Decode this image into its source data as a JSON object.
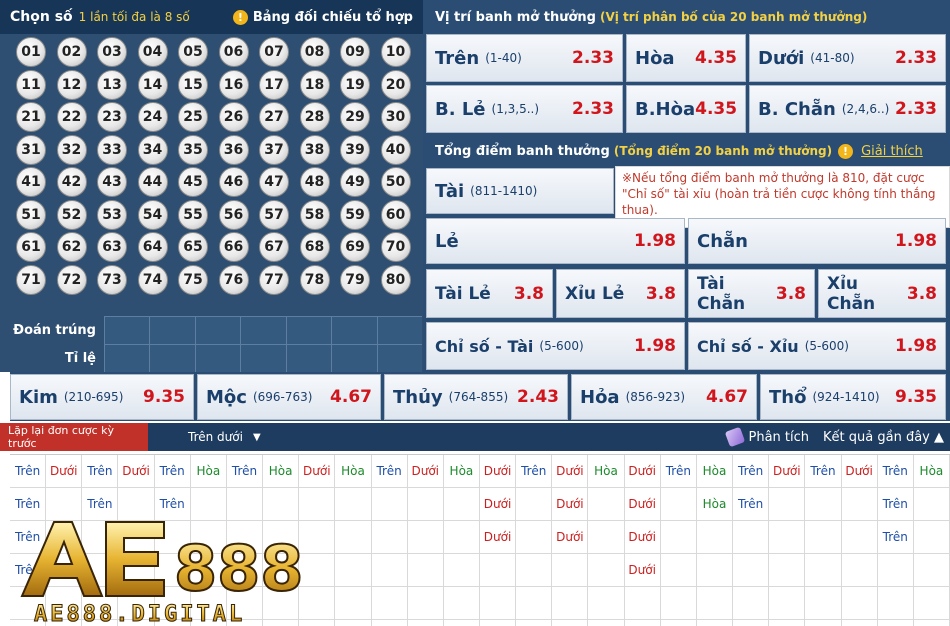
{
  "left": {
    "title": "Chọn số",
    "subtitle": "1 lần tối đa là 8 số",
    "compare_label": "Bảng đối chiếu tổ hợp",
    "balls": [
      "01",
      "02",
      "03",
      "04",
      "05",
      "06",
      "07",
      "08",
      "09",
      "10",
      "11",
      "12",
      "13",
      "14",
      "15",
      "16",
      "17",
      "18",
      "19",
      "20",
      "21",
      "22",
      "23",
      "24",
      "25",
      "26",
      "27",
      "28",
      "29",
      "30",
      "31",
      "32",
      "33",
      "34",
      "35",
      "36",
      "37",
      "38",
      "39",
      "40",
      "41",
      "42",
      "43",
      "44",
      "45",
      "46",
      "47",
      "48",
      "49",
      "50",
      "51",
      "52",
      "53",
      "54",
      "55",
      "56",
      "57",
      "58",
      "59",
      "60",
      "61",
      "62",
      "63",
      "64",
      "65",
      "66",
      "67",
      "68",
      "69",
      "70",
      "71",
      "72",
      "73",
      "74",
      "75",
      "76",
      "77",
      "78",
      "79",
      "80"
    ],
    "win_label": "Đoán trúng",
    "ratio_label": "Tỉ lệ"
  },
  "position": {
    "title": "Vị trí banh mở thưởng",
    "subtitle": "(Vị trí phân bố của 20 banh mở thưởng)",
    "odds": [
      {
        "label": "Trên",
        "range": "(1-40)",
        "value": "2.33"
      },
      {
        "label": "Hòa",
        "range": "",
        "value": "4.35"
      },
      {
        "label": "Dưới",
        "range": "(41-80)",
        "value": "2.33"
      },
      {
        "label": "B. Lẻ",
        "range": "(1,3,5..)",
        "value": "2.33"
      },
      {
        "label": "B.Hòa",
        "range": "",
        "value": "4.35"
      },
      {
        "label": "B. Chẵn",
        "range": "(2,4,6..)",
        "value": "2.33"
      }
    ]
  },
  "sum": {
    "title": "Tổng điểm banh thưởng",
    "subtitle": "(Tổng điểm 20 banh mở thưởng)",
    "explain_link": "Giải thích",
    "tooltip": "※Nếu tổng điểm banh mở thưởng là 810, đặt cược \"Chỉ số\" tài xỉu (hoàn trả tiền cược không tính thắng thua).",
    "tai": {
      "label": "Tài",
      "range": "(811-1410)"
    },
    "le": {
      "label": "Lẻ",
      "value": "1.98"
    },
    "chan": {
      "label": "Chẵn",
      "value": "1.98"
    },
    "combos": [
      {
        "label": "Tài Lẻ",
        "value": "3.8"
      },
      {
        "label": "Xỉu Lẻ",
        "value": "3.8"
      },
      {
        "label": "Tài Chẵn",
        "value": "3.8"
      },
      {
        "label": "Xỉu Chẵn",
        "value": "3.8"
      }
    ],
    "index": [
      {
        "label": "Chỉ số - Tài",
        "range": "(5-600)",
        "value": "1.98"
      },
      {
        "label": "Chỉ số - Xỉu",
        "range": "(5-600)",
        "value": "1.98"
      }
    ]
  },
  "elements": [
    {
      "label": "Kim",
      "range": "(210-695)",
      "value": "9.35"
    },
    {
      "label": "Mộc",
      "range": "(696-763)",
      "value": "4.67"
    },
    {
      "label": "Thủy",
      "range": "(764-855)",
      "value": "2.43"
    },
    {
      "label": "Hỏa",
      "range": "(856-923)",
      "value": "4.67"
    },
    {
      "label": "Thổ",
      "range": "(924-1410)",
      "value": "9.35"
    }
  ],
  "toolbar": {
    "repeat_label": "Lặp lại đơn cược kỳ trước",
    "select_value": "Trên dưới",
    "analyze_label": "Phân tích",
    "recent_label": "Kết quả gần đây ▲"
  },
  "history": {
    "header": [
      "Trên",
      "Dưới",
      "Trên",
      "Dưới",
      "Trên",
      "Hòa",
      "Trên",
      "Hòa",
      "Dưới",
      "Hòa",
      "Trên",
      "Dưới",
      "Hòa",
      "Dưới",
      "Trên",
      "Dưới",
      "Hòa",
      "Dưới",
      "Trên",
      "Hòa",
      "Trên",
      "Dưới",
      "Trên",
      "Dưới",
      "Trên",
      "Hòa"
    ],
    "rows": [
      [
        "Trên",
        "",
        "Trên",
        "",
        "Trên",
        "",
        "",
        "",
        "",
        "",
        "",
        "",
        "",
        "Dưới",
        "",
        "Dưới",
        "",
        "Dưới",
        "",
        "Hòa",
        "Trên",
        "",
        "",
        "",
        "Trên",
        ""
      ],
      [
        "Trên",
        "",
        "",
        "",
        "",
        "",
        "",
        "",
        "",
        "",
        "",
        "",
        "",
        "Dưới",
        "",
        "Dưới",
        "",
        "Dưới",
        "",
        "",
        "",
        "",
        "",
        "",
        "Trên",
        ""
      ],
      [
        "Trên",
        "",
        "",
        "",
        "",
        "",
        "",
        "",
        "",
        "",
        "",
        "",
        "",
        "",
        "",
        "",
        "",
        "Dưới",
        "",
        "",
        "",
        "",
        "",
        "",
        "",
        ""
      ]
    ]
  },
  "logo": {
    "brand": "AE888",
    "domain": "AE888.DIGITAL"
  },
  "colors": {
    "panel": "#2b4d73",
    "odds_red": "#d0161c",
    "accent_yellow": "#f3d145"
  }
}
